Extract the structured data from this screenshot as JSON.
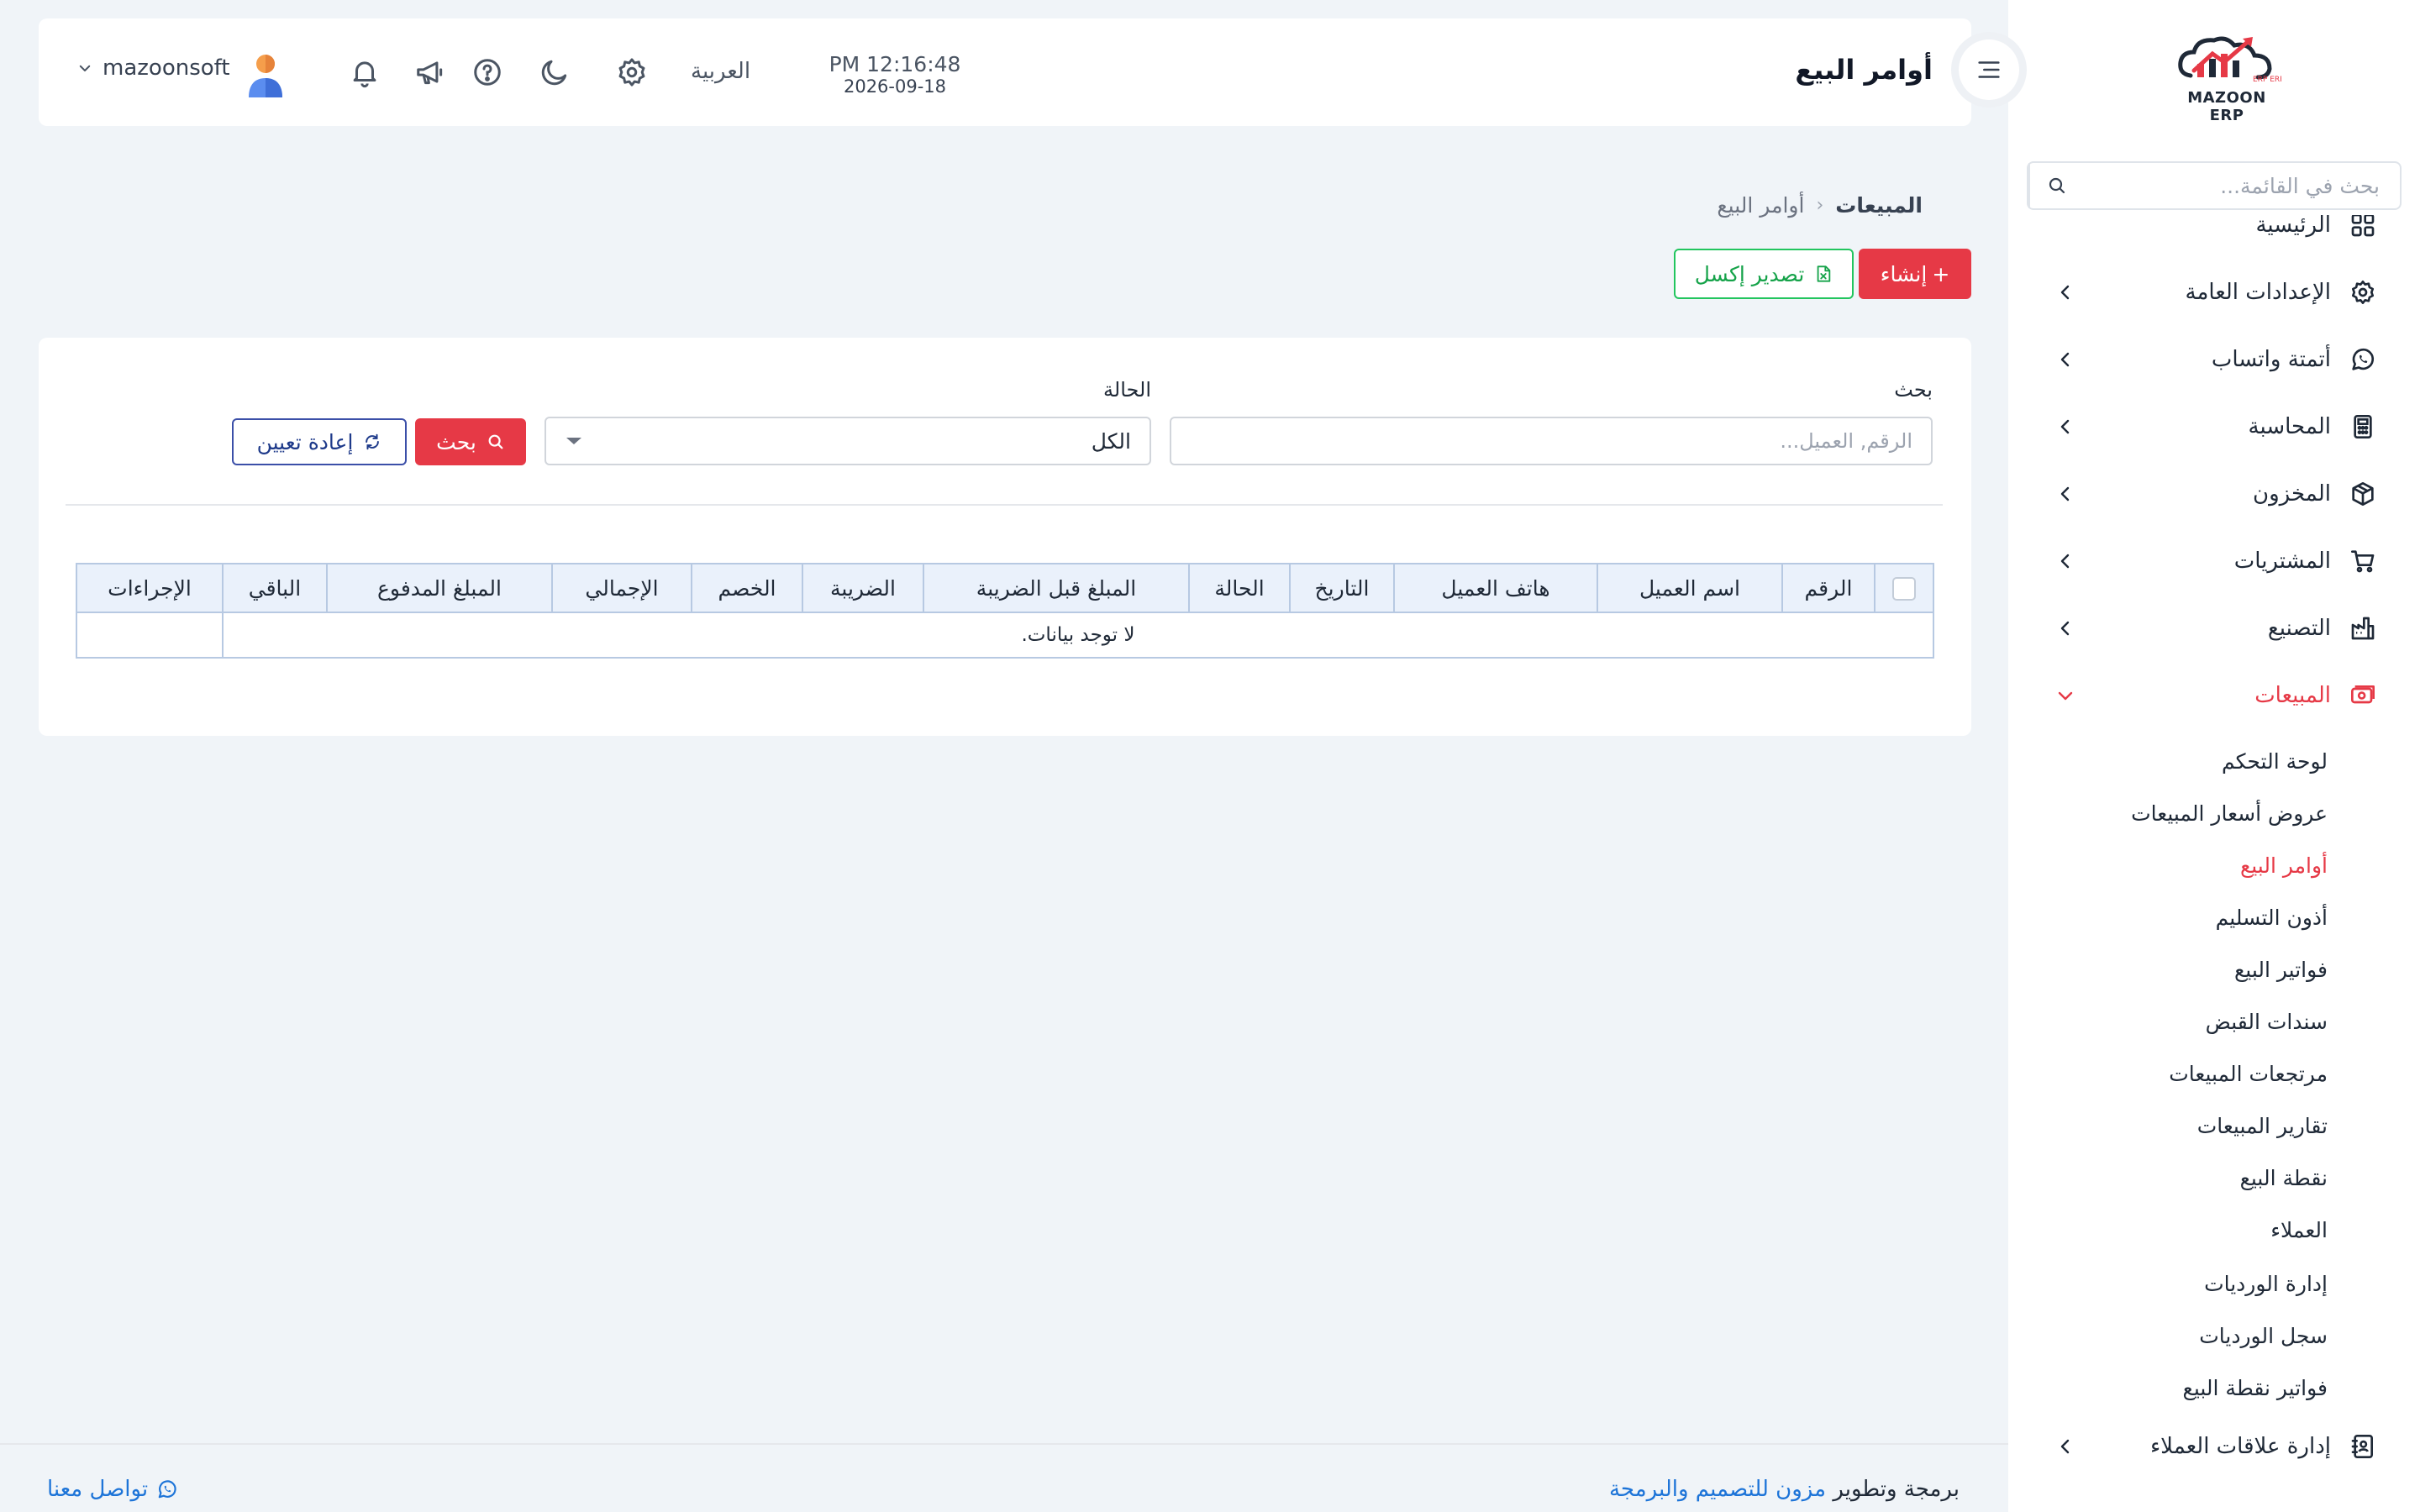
{
  "header": {
    "page_title": "أوامر البيع",
    "time": "PM 12:16:48",
    "date": "2026-09-18",
    "language": "العربية",
    "username": "mazoonsoft"
  },
  "sidebar": {
    "logo_text": "MAZOON ERP",
    "logo_small": "ERP ERP",
    "search_placeholder": "بحث في القائمة...",
    "items": [
      {
        "label": "الرئيسية",
        "icon": "grid-icon"
      },
      {
        "label": "الإعدادات العامة",
        "icon": "gear-icon"
      },
      {
        "label": "أتمتة واتساب",
        "icon": "whatsapp-icon"
      },
      {
        "label": "المحاسبة",
        "icon": "calculator-icon"
      },
      {
        "label": "المخزون",
        "icon": "box-icon"
      },
      {
        "label": "المشتريات",
        "icon": "cart-icon"
      },
      {
        "label": "التصنيع",
        "icon": "factory-icon"
      },
      {
        "label": "المبيعات",
        "icon": "cash-register-icon"
      },
      {
        "label": "إدارة علاقات العملاء",
        "icon": "contacts-icon"
      }
    ],
    "sales_submenu": [
      "لوحة التحكم",
      "عروض أسعار المبيعات",
      "أوامر البيع",
      "أذون التسليم",
      "فواتير البيع",
      "سندات القبض",
      "مرتجعات المبيعات",
      "تقارير المبيعات",
      "نقطة البيع",
      "العملاء",
      "إدارة الورديات",
      "سجل الورديات",
      "فواتير نقطة البيع"
    ]
  },
  "breadcrumb": {
    "parent": "المبيعات",
    "separator": "‹",
    "current": "أوامر البيع"
  },
  "actions": {
    "create_label": "إنشاء",
    "create_plus": "+",
    "excel_label": "تصدير إكسل"
  },
  "filters": {
    "search_label": "بحث",
    "search_placeholder": "الرقم, العميل...",
    "status_label": "الحالة",
    "status_value": "الكل",
    "search_button": "بحث",
    "reset_button": "إعادة تعيين"
  },
  "table": {
    "columns": [
      "الرقم",
      "اسم العميل",
      "هاتف العميل",
      "التاريخ",
      "الحالة",
      "المبلغ قبل الضريبة",
      "الضريبة",
      "الخصم",
      "الإجمالي",
      "المبلغ المدفوع",
      "الباقي",
      "الإجراءات"
    ],
    "empty_message": "لا توجد بيانات."
  },
  "footer": {
    "credit_prefix": "برمجة وتطوير",
    "credit_link": "مزون للتصميم والبرمجة",
    "contact": "تواصل معنا"
  },
  "colors": {
    "accent": "#e63946",
    "success": "#22c55e",
    "link": "#1d74d8",
    "navy": "#1e3a8a"
  }
}
